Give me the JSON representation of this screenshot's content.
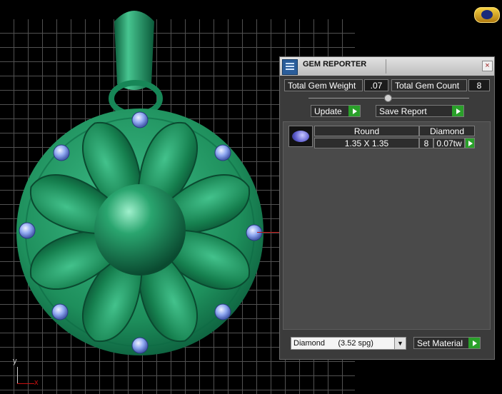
{
  "viewport": {
    "axis_y_label": "y",
    "axis_x_label": "x"
  },
  "panel": {
    "title": "GEM REPORTER",
    "close_label": "×",
    "total_gem_weight_label": "Total Gem Weight",
    "total_gem_weight_value": ".07",
    "total_gem_count_label": "Total Gem Count",
    "total_gem_count_value": "8",
    "update_label": "Update",
    "save_report_label": "Save Report",
    "report_rows": [
      {
        "shape": "Round",
        "material": "Diamond",
        "size": "1.35 X 1.35",
        "count": "8",
        "weight": "0.07tw"
      }
    ],
    "material_select_value": "Diamond      (3.52 spg)",
    "set_material_label": "Set Material"
  },
  "colors": {
    "pendant_green": "#1e8f5c",
    "pendant_dark": "#0b5a3a",
    "gem_blue": "#8fa8f0",
    "accent_green_button": "#2aa02a",
    "grid_line": "#5a5a5a"
  },
  "icons": [
    "gem-reporter-icon",
    "close-icon",
    "play-arrow-icon",
    "dropdown-arrow-icon",
    "app-logo-icon"
  ]
}
